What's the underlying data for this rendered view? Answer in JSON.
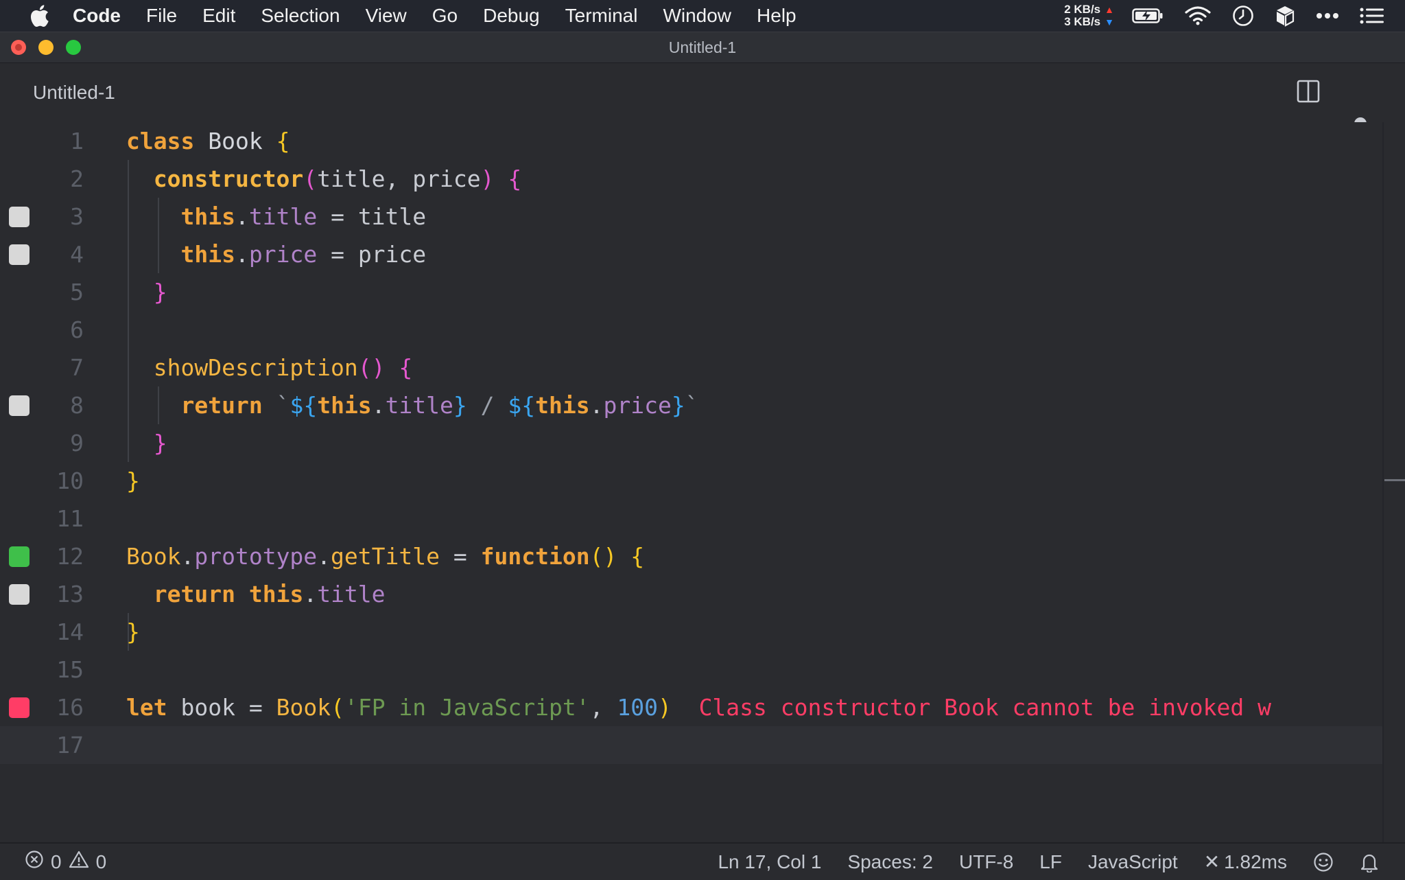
{
  "menubar": {
    "app": "Code",
    "items": [
      "File",
      "Edit",
      "Selection",
      "View",
      "Go",
      "Debug",
      "Terminal",
      "Window",
      "Help"
    ],
    "net_up": "2 KB/s",
    "net_down": "3 KB/s"
  },
  "window": {
    "title": "Untitled-1"
  },
  "tab": {
    "label": "Untitled-1"
  },
  "editor": {
    "line_numbers": [
      "1",
      "2",
      "3",
      "4",
      "5",
      "6",
      "7",
      "8",
      "9",
      "10",
      "11",
      "12",
      "13",
      "14",
      "15",
      "16",
      "17"
    ],
    "error_message": "Class constructor Book cannot be invoked w",
    "markers": {
      "3": "#d8d8d8",
      "4": "#d8d8d8",
      "8": "#d8d8d8",
      "12": "#3fbf4a",
      "13": "#d8d8d8",
      "16": "#ff3d66"
    },
    "tokens": {
      "l1": [
        "class",
        "Book",
        "{"
      ],
      "l2": [
        "constructor",
        "(",
        "title",
        ",",
        "price",
        ")",
        "{"
      ],
      "l3": [
        "this",
        ".",
        "title",
        "=",
        "title"
      ],
      "l4": [
        "this",
        ".",
        "price",
        "=",
        "price"
      ],
      "l5": [
        "}"
      ],
      "l7": [
        "showDescription",
        "()",
        "{"
      ],
      "l8": [
        "return",
        "`",
        "${",
        "this",
        ".",
        "title",
        "}",
        "/",
        "${",
        "this",
        ".",
        "price",
        "}",
        "`"
      ],
      "l9": [
        "}"
      ],
      "l10": [
        "}"
      ],
      "l12": [
        "Book",
        ".",
        "prototype",
        ".",
        "getTitle",
        "=",
        "function",
        "()",
        "{"
      ],
      "l13": [
        "return",
        "this",
        ".",
        "title"
      ],
      "l14": [
        "}"
      ],
      "l16": [
        "let",
        "book",
        "=",
        "Book",
        "(",
        "'FP in JavaScript'",
        ",",
        "100",
        ")"
      ]
    }
  },
  "statusbar": {
    "errors": "0",
    "warnings": "0",
    "position": "Ln 17, Col 1",
    "spaces": "Spaces: 2",
    "encoding": "UTF-8",
    "eol": "LF",
    "language": "JavaScript",
    "timing": "1.82ms"
  }
}
